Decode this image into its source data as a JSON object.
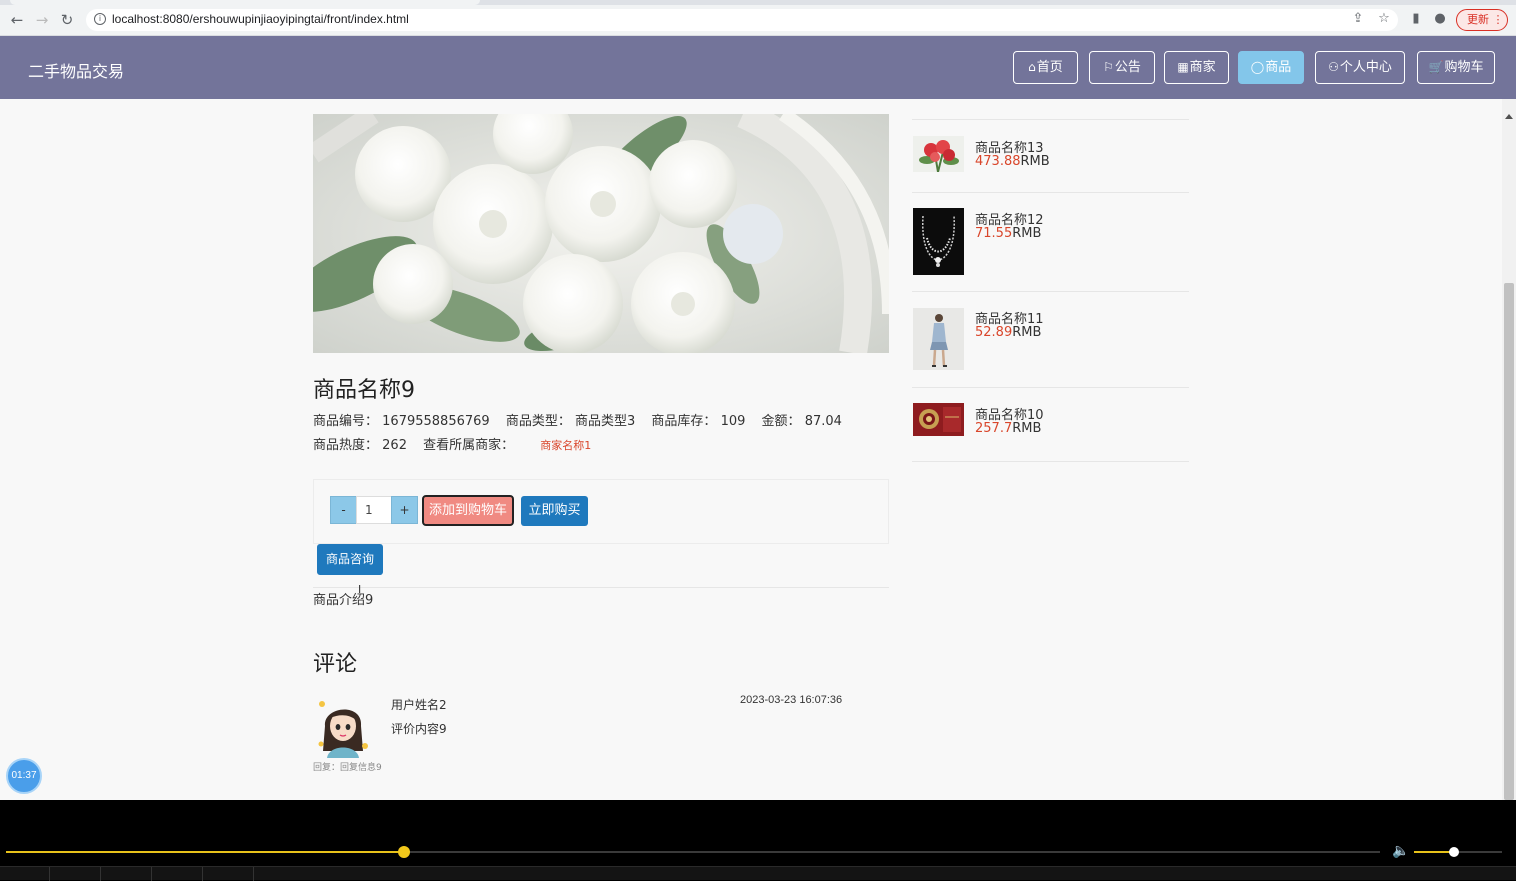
{
  "browser": {
    "url": "localhost:8080/ershouwupinjiaoyipingtai/front/index.html",
    "update_label": "更新"
  },
  "header": {
    "brand": "二手物品交易",
    "nav": [
      {
        "icon": "⌂",
        "label": "首页",
        "active": false
      },
      {
        "icon": "⚐",
        "label": "公告",
        "active": false
      },
      {
        "icon": "▦",
        "label": "商家",
        "active": false
      },
      {
        "icon": "◯",
        "label": "商品",
        "active": true
      },
      {
        "icon": "⚇",
        "label": "个人中心",
        "active": false
      },
      {
        "icon": "🛒",
        "label": "购物车",
        "active": false
      }
    ]
  },
  "product": {
    "name": "商品名称9",
    "code_label": "商品编号：",
    "code": "1679558856769",
    "type_label": "商品类型：",
    "type": "商品类型3",
    "stock_label": "商品库存：",
    "stock": "109",
    "price_label": "金额：",
    "price": "87.04",
    "heat_label": "商品热度：",
    "heat": "262",
    "merchant_label": "查看所属商家：",
    "merchant": "商家名称1",
    "quantity": "1",
    "minus_label": "-",
    "plus_label": "+",
    "add_cart_label": "添加到购物车",
    "buy_now_label": "立即购买",
    "consult_label": "商品咨询",
    "intro": "商品介绍9"
  },
  "comments": {
    "title": "评论",
    "items": [
      {
        "user": "用户姓名2",
        "content": "评价内容9",
        "time": "2023-03-23 16:07:36",
        "reply": "回复：回复信息9"
      }
    ]
  },
  "recommendations": [
    {
      "name": "商品名称13",
      "price": "473.88",
      "unit": "RMB",
      "thumb": "red-roses-icon"
    },
    {
      "name": "商品名称12",
      "price": "71.55",
      "unit": "RMB",
      "thumb": "necklace-icon"
    },
    {
      "name": "商品名称11",
      "price": "52.89",
      "unit": "RMB",
      "thumb": "fashion-model-icon"
    },
    {
      "name": "商品名称10",
      "price": "257.7",
      "unit": "RMB",
      "thumb": "gift-box-icon"
    }
  ],
  "player": {
    "timer": "01:37",
    "progress": 0.29,
    "volume": 0.45
  },
  "colors": {
    "header_bg": "#73749a",
    "active_nav": "#83c6ea",
    "price_red": "#d9462b",
    "primary_blue": "#1f79bd",
    "cart_button": "#f08a82"
  }
}
